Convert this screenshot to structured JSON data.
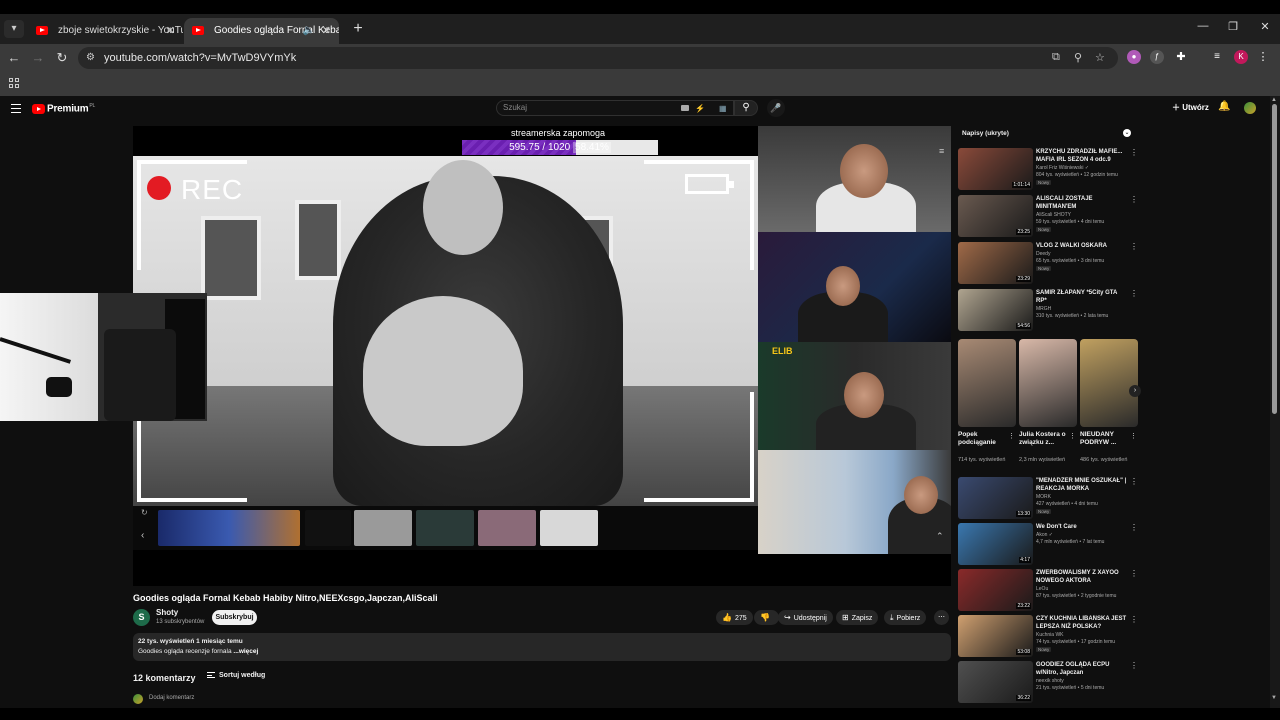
{
  "browser": {
    "tabs": [
      {
        "title": "zboje swietokrzyskie - YouTube",
        "active": false
      },
      {
        "title": "Goodies ogląda Fornal Kebab",
        "active": true
      }
    ],
    "url": "youtube.com/watch?v=MvTwD9VYmYk",
    "profile_initial": "K"
  },
  "masthead": {
    "brand": "Premium",
    "brand_suffix": "PL",
    "search_placeholder": "Szukaj",
    "create_label": "Utwórz"
  },
  "player": {
    "overlay_title": "streamerska zapomoga",
    "goal_text": "595.75 / 1020",
    "goal_percent": "58.41%",
    "goal_fraction": 0.5841,
    "rec_label": "REC",
    "cam_tag": "ELIB",
    "accent_color": "#7a2fc0"
  },
  "video": {
    "title": "Goodies ogląda Fornal Kebab Habiby Nitro,NEEXcsgo,Japczan,AliScali",
    "channel": {
      "initial": "S",
      "name": "Shoty",
      "subscribers": "13 subskrybentów"
    },
    "subscribe_label": "Subskrybuj",
    "likes": "275",
    "share_label": "Udostępnij",
    "save_label": "Zapisz",
    "download_label": "Pobierz",
    "views_date": "22 tys. wyświetleń  1 miesiąc temu",
    "description": "Goodies ogląda recenzje fornala",
    "more_label": "...więcej"
  },
  "comments": {
    "count_label": "12 komentarzy",
    "sort_label": "Sortuj według",
    "add_placeholder": "Dodaj komentarz"
  },
  "sidebar": {
    "chat_header": "Napisy (ukryte)",
    "recommendations_top": [
      {
        "title": "KRZYCHU ZDRADZIŁ MAFIE... MAFIA IRL SEZON 4 odc.9",
        "channel": "Karol Friz Wiśniewski ✓",
        "meta": "804 tys. wyświetleń • 12 godzin temu",
        "badge": "Nowy",
        "duration": "1:01:14",
        "color": "#8a4a3a"
      },
      {
        "title": "ALISCALI ZOSTAJE MINITMAN'EM",
        "channel": "AliScali SHOTY",
        "meta": "59 tys. wyświetleń • 4 dni temu",
        "badge": "Nowy",
        "duration": "23:25",
        "color": "#6a5a50"
      },
      {
        "title": "VLOG Z WALKI OSKARA",
        "channel": "Deedy",
        "meta": "65 tys. wyświetleń • 3 dni temu",
        "badge": "Nowy",
        "duration": "23:29",
        "color": "#a06a48"
      },
      {
        "title": "SAMIR ZŁAPANY *5City GTA RP*",
        "channel": "MRGH",
        "meta": "310 tys. wyświetleń • 2 lata temu",
        "badge": "",
        "duration": "54:56",
        "color": "#b0a590"
      }
    ],
    "shorts": [
      {
        "title": "Popek podciąganie",
        "views": "714 tys. wyświetleń",
        "color": "#a88a74"
      },
      {
        "title": "Julia Kostera o związku z...",
        "views": "2,3 mln wyświetleń",
        "color": "#d8b8a8"
      },
      {
        "title": "NIEUDANY PODRYW ...",
        "views": "486 tys. wyświetleń",
        "color": "#c0a060"
      }
    ],
    "recommendations_bottom": [
      {
        "title": "\"MENADŻER MNIE OSZUKAŁ\" | REAKCJA MORKA",
        "channel": "MORK",
        "meta": "427 wyświetleń • 4 dni temu",
        "badge": "Nowy",
        "duration": "13:30",
        "color": "#3a4a70"
      },
      {
        "title": "We Don't Care",
        "channel": "Akon ✓",
        "meta": "4,7 mln wyświetleń • 7 lat temu",
        "badge": "",
        "duration": "4:17",
        "color": "#3a78b0"
      },
      {
        "title": "ZWERBOWALIŚMY Z XAYOO NOWEGO AKTORA",
        "channel": "LeOu",
        "meta": "87 tys. wyświetleń • 2 tygodnie temu",
        "badge": "",
        "duration": "23:22",
        "color": "#8a2a2a"
      },
      {
        "title": "CZY KUCHNIA LIBAŃSKA JEST LEPSZA NIŻ POLSKA?",
        "channel": "Kuchnia WK",
        "meta": "74 tys. wyświetleń • 17 godzin temu",
        "badge": "Nowy",
        "duration": "53:08",
        "color": "#d0a070"
      },
      {
        "title": "GOODIEZ OGLĄDA ECPU w/Nitro, Japczan",
        "channel": "neexik shoty",
        "meta": "21 tys. wyświetleń • 5 dni temu",
        "badge": "",
        "duration": "36:22",
        "color": "#505050"
      }
    ]
  }
}
